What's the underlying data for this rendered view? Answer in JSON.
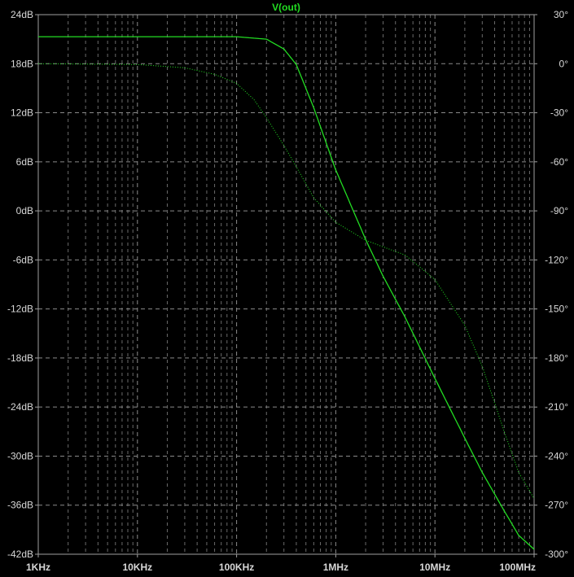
{
  "chart_data": {
    "type": "line",
    "title": "V(out)",
    "x_scale": "log",
    "xlim": [
      1000,
      100000000
    ],
    "x_tick_values": [
      1000,
      10000,
      100000,
      1000000,
      10000000,
      100000000
    ],
    "x_tick_labels": [
      "1KHz",
      "10KHz",
      "100KHz",
      "1MHz",
      "10MHz",
      "100MHz"
    ],
    "y_left": {
      "unit": "dB",
      "lim": [
        -42,
        24
      ],
      "tick_values": [
        24,
        18,
        12,
        6,
        0,
        -6,
        -12,
        -18,
        -24,
        -30,
        -36,
        -42
      ],
      "tick_labels": [
        "24dB",
        "18dB",
        "12dB",
        "6dB",
        "0dB",
        "-6dB",
        "-12dB",
        "-18dB",
        "-24dB",
        "-30dB",
        "-36dB",
        "-42dB"
      ]
    },
    "y_right": {
      "unit": "degree",
      "lim": [
        -300,
        30
      ],
      "tick_values": [
        30,
        0,
        -30,
        -60,
        -90,
        -120,
        -150,
        -180,
        -210,
        -240,
        -270,
        -300
      ],
      "tick_labels": [
        "30°",
        "0°",
        "-30°",
        "-60°",
        "-90°",
        "-120°",
        "-150°",
        "-180°",
        "-210°",
        "-240°",
        "-270°",
        "-300°"
      ]
    },
    "grid": true,
    "series": [
      {
        "axis": "left",
        "style": "solid",
        "color": "#22dd22",
        "x": [
          1000,
          10000,
          100000,
          200000,
          300000,
          400000,
          600000,
          1000000,
          2000000,
          3000000,
          5000000,
          10000000,
          20000000,
          30000000,
          50000000,
          70000000,
          100000000
        ],
        "y": [
          21.3,
          21.3,
          21.3,
          21.0,
          19.8,
          17.9,
          12.6,
          5.0,
          -3.5,
          -8.0,
          -13.0,
          -20.5,
          -27.8,
          -32.0,
          -36.7,
          -39.7,
          -41.4
        ]
      },
      {
        "axis": "right",
        "style": "dotted",
        "color": "#22dd22",
        "x": [
          1000,
          10000,
          30000,
          60000,
          100000,
          150000,
          200000,
          300000,
          400000,
          600000,
          1000000,
          2000000,
          3000000,
          5000000,
          10000000,
          20000000,
          30000000,
          50000000,
          70000000,
          100000000
        ],
        "y": [
          0.0,
          -0.5,
          -2.5,
          -6.5,
          -12.0,
          -22.0,
          -33.0,
          -50.0,
          -63.0,
          -82.0,
          -97.0,
          -108.0,
          -112.0,
          -117.0,
          -132.0,
          -160.0,
          -185.0,
          -225.0,
          -250.0,
          -266.0
        ]
      }
    ]
  }
}
